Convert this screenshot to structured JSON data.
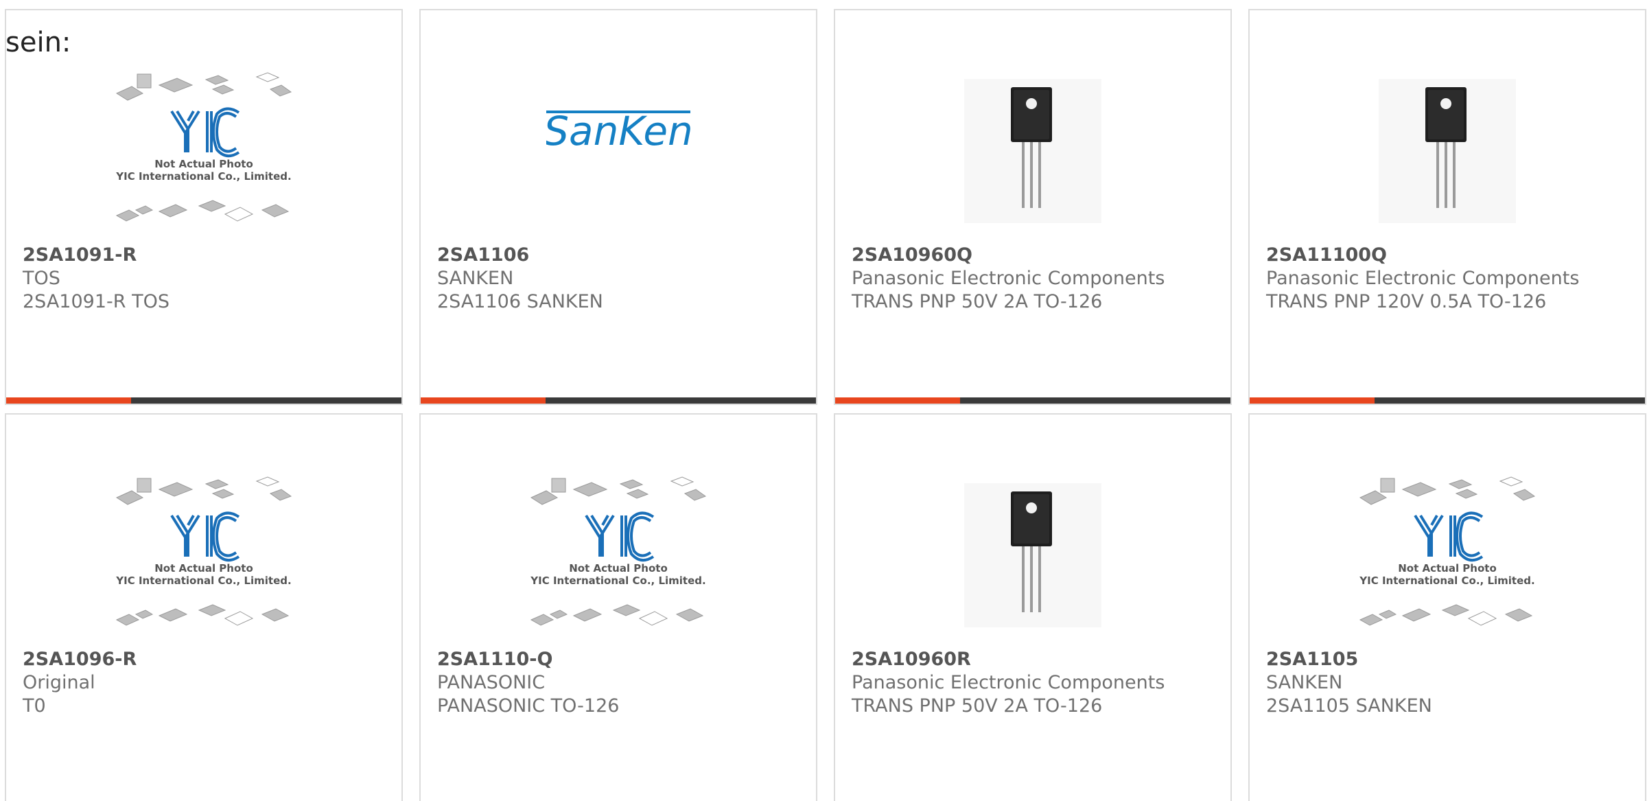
{
  "intro": "sein:",
  "colors": {
    "accent": "#e8461e",
    "bar": "#3a3a3a",
    "yic_blue": "#1a6fb8",
    "sanken_blue": "#1580c4"
  },
  "placeholder": {
    "line1": "Not Actual Photo",
    "line2": "YIC International Co., Limited."
  },
  "sanken_logo_text": "SanKen",
  "products": [
    {
      "part": "2SA1091-R",
      "maker": "TOS",
      "desc": "2SA1091-R TOS",
      "image": "yic-placeholder"
    },
    {
      "part": "2SA1106",
      "maker": "SANKEN",
      "desc": "2SA1106 SANKEN",
      "image": "sanken-logo"
    },
    {
      "part": "2SA10960Q",
      "maker": "Panasonic Electronic Components",
      "desc": "TRANS PNP 50V 2A TO-126",
      "image": "transistor-photo"
    },
    {
      "part": "2SA11100Q",
      "maker": "Panasonic Electronic Components",
      "desc": "TRANS PNP 120V 0.5A TO-126",
      "image": "transistor-photo"
    },
    {
      "part": "2SA1096-R",
      "maker": "Original",
      "desc": "T0",
      "image": "yic-placeholder"
    },
    {
      "part": "2SA1110-Q",
      "maker": "PANASONIC",
      "desc": "PANASONIC TO-126",
      "image": "yic-placeholder"
    },
    {
      "part": "2SA10960R",
      "maker": "Panasonic Electronic Components",
      "desc": "TRANS PNP 50V 2A TO-126",
      "image": "transistor-photo"
    },
    {
      "part": "2SA1105",
      "maker": "SANKEN",
      "desc": "2SA1105 SANKEN",
      "image": "yic-placeholder"
    }
  ]
}
